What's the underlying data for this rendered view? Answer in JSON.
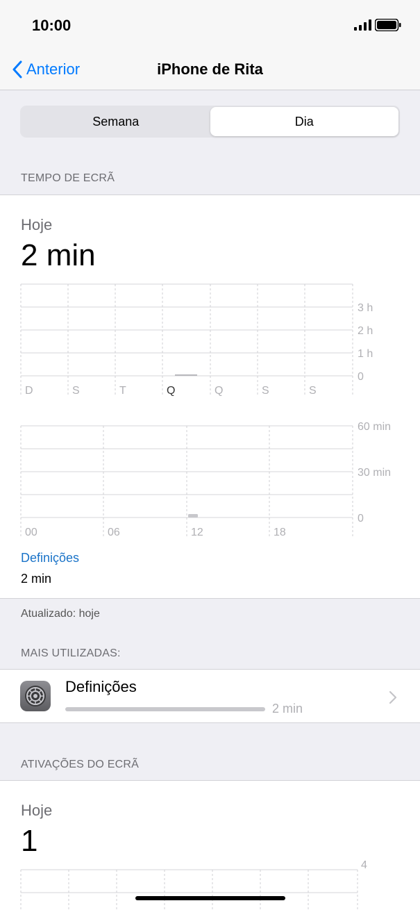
{
  "status_bar": {
    "time": "10:00"
  },
  "nav": {
    "back_label": "Anterior",
    "title": "iPhone de Rita"
  },
  "segmented": {
    "week": "Semana",
    "day": "Dia",
    "selected": "day"
  },
  "screen_time": {
    "header": "TEMPO DE ECRÃ",
    "period": "Hoje",
    "total": "2 min",
    "weekly_chart": {
      "type": "bar",
      "categories": [
        "D",
        "S",
        "T",
        "Q",
        "Q",
        "S",
        "S"
      ],
      "highlighted_index": 3,
      "y_ticks": [
        "3 h",
        "2 h",
        "1 h",
        "0"
      ],
      "values_min": [
        0,
        0,
        0,
        2,
        0,
        0,
        0
      ]
    },
    "hourly_chart": {
      "type": "bar",
      "x_ticks": [
        "00",
        "06",
        "12",
        "18"
      ],
      "y_ticks": [
        "60 min",
        "30 min",
        "0"
      ],
      "values_min_by_hour": [
        0,
        0,
        0,
        0,
        0,
        0,
        0,
        0,
        0,
        0,
        0,
        0,
        2,
        0,
        0,
        0,
        0,
        0,
        0,
        0,
        0,
        0,
        0,
        0
      ]
    },
    "category_label": "Definições",
    "category_value": "2 min"
  },
  "updated": "Atualizado: hoje",
  "most_used": {
    "header": "MAIS UTILIZADAS:",
    "items": [
      {
        "name": "Definições",
        "usage": "2 min",
        "icon": "settings-gear-icon"
      }
    ]
  },
  "pickups": {
    "header": "ATIVAÇÕES DO ECRÃ",
    "period": "Hoje",
    "total": "1",
    "chart": {
      "type": "bar",
      "y_ticks": [
        "4"
      ]
    }
  },
  "colors": {
    "accent": "#007aff",
    "link": "#1a73c8",
    "background": "#efeff4"
  }
}
